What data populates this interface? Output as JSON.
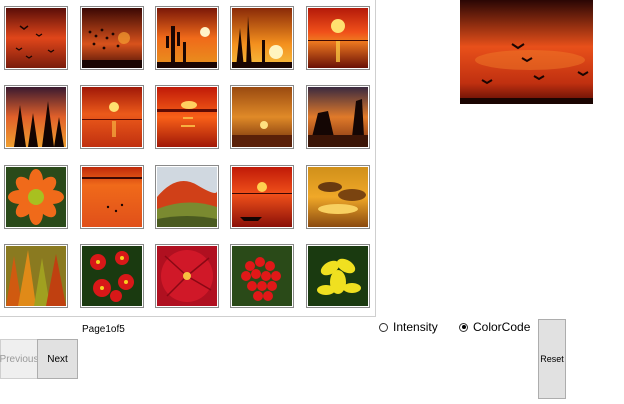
{
  "gallery": {
    "thumbnails": [
      {
        "subject": "birds-at-sunset"
      },
      {
        "subject": "flock-of-birds"
      },
      {
        "subject": "cactus-sunset"
      },
      {
        "subject": "desert-plants-sunset"
      },
      {
        "subject": "ocean-sunset"
      },
      {
        "subject": "pine-trees-silhouette"
      },
      {
        "subject": "sun-over-sea"
      },
      {
        "subject": "red-sky-sunset"
      },
      {
        "subject": "hazy-sunset"
      },
      {
        "subject": "sea-stacks-sunset"
      },
      {
        "subject": "orange-flower"
      },
      {
        "subject": "birds-over-water"
      },
      {
        "subject": "red-hills-landscape"
      },
      {
        "subject": "boat-at-sunset"
      },
      {
        "subject": "golden-clouds"
      },
      {
        "subject": "autumn-trees"
      },
      {
        "subject": "red-flowers"
      },
      {
        "subject": "red-hibiscus"
      },
      {
        "subject": "red-berries"
      },
      {
        "subject": "yellow-flowers"
      }
    ]
  },
  "preview": {
    "subject": "birds-at-sunset-preview"
  },
  "pagination": {
    "page_info": "Page1of5",
    "previous_label": "Previous",
    "next_label": "Next"
  },
  "mode": {
    "intensity_label": "Intensity",
    "colorcode_label": "ColorCode",
    "selected": "ColorCode"
  },
  "reset_label": "Reset"
}
